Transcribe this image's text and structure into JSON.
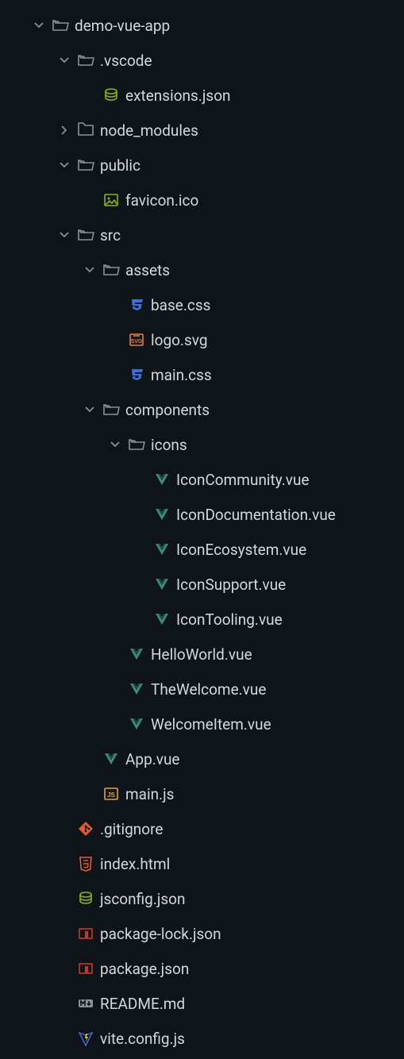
{
  "tree": [
    {
      "depth": 0,
      "expanded": true,
      "icon": "folder-open",
      "label": "demo-vue-app"
    },
    {
      "depth": 1,
      "expanded": true,
      "icon": "folder-open",
      "label": ".vscode"
    },
    {
      "depth": 2,
      "expanded": null,
      "icon": "json",
      "label": "extensions.json"
    },
    {
      "depth": 1,
      "expanded": false,
      "icon": "folder",
      "label": "node_modules"
    },
    {
      "depth": 1,
      "expanded": true,
      "icon": "folder-open",
      "label": "public"
    },
    {
      "depth": 2,
      "expanded": null,
      "icon": "image",
      "label": "favicon.ico"
    },
    {
      "depth": 1,
      "expanded": true,
      "icon": "folder-open",
      "label": "src"
    },
    {
      "depth": 2,
      "expanded": true,
      "icon": "folder-open",
      "label": "assets"
    },
    {
      "depth": 3,
      "expanded": null,
      "icon": "css",
      "label": "base.css"
    },
    {
      "depth": 3,
      "expanded": null,
      "icon": "svg",
      "label": "logo.svg"
    },
    {
      "depth": 3,
      "expanded": null,
      "icon": "css",
      "label": "main.css"
    },
    {
      "depth": 2,
      "expanded": true,
      "icon": "folder-open",
      "label": "components"
    },
    {
      "depth": 3,
      "expanded": true,
      "icon": "folder-open",
      "label": "icons"
    },
    {
      "depth": 4,
      "expanded": null,
      "icon": "vue",
      "label": "IconCommunity.vue"
    },
    {
      "depth": 4,
      "expanded": null,
      "icon": "vue",
      "label": "IconDocumentation.vue"
    },
    {
      "depth": 4,
      "expanded": null,
      "icon": "vue",
      "label": "IconEcosystem.vue"
    },
    {
      "depth": 4,
      "expanded": null,
      "icon": "vue",
      "label": "IconSupport.vue"
    },
    {
      "depth": 4,
      "expanded": null,
      "icon": "vue",
      "label": "IconTooling.vue"
    },
    {
      "depth": 3,
      "expanded": null,
      "icon": "vue",
      "label": "HelloWorld.vue"
    },
    {
      "depth": 3,
      "expanded": null,
      "icon": "vue",
      "label": "TheWelcome.vue"
    },
    {
      "depth": 3,
      "expanded": null,
      "icon": "vue",
      "label": "WelcomeItem.vue"
    },
    {
      "depth": 2,
      "expanded": null,
      "icon": "vue",
      "label": "App.vue"
    },
    {
      "depth": 2,
      "expanded": null,
      "icon": "js",
      "label": "main.js"
    },
    {
      "depth": 1,
      "expanded": null,
      "icon": "git",
      "label": ".gitignore"
    },
    {
      "depth": 1,
      "expanded": null,
      "icon": "html",
      "label": "index.html"
    },
    {
      "depth": 1,
      "expanded": null,
      "icon": "json",
      "label": "jsconfig.json"
    },
    {
      "depth": 1,
      "expanded": null,
      "icon": "npm",
      "label": "package-lock.json"
    },
    {
      "depth": 1,
      "expanded": null,
      "icon": "npm",
      "label": "package.json"
    },
    {
      "depth": 1,
      "expanded": null,
      "icon": "md",
      "label": "README.md"
    },
    {
      "depth": 1,
      "expanded": null,
      "icon": "vite",
      "label": "vite.config.js"
    }
  ],
  "icons": {
    "folder": "#8a9199",
    "folder-open": "#8a9199",
    "json": "#8ab700",
    "image": "#8ab700",
    "css": "#3574e0",
    "svg": "#e67e3c",
    "vue": "#3a8f7a",
    "js": "#e6a23c",
    "git": "#e05e2b",
    "html": "#e05e2b",
    "npm": "#c7362e",
    "md": "#8a9199",
    "vite": "#4a6dd8"
  },
  "indentPx": 32,
  "basePad": 36
}
